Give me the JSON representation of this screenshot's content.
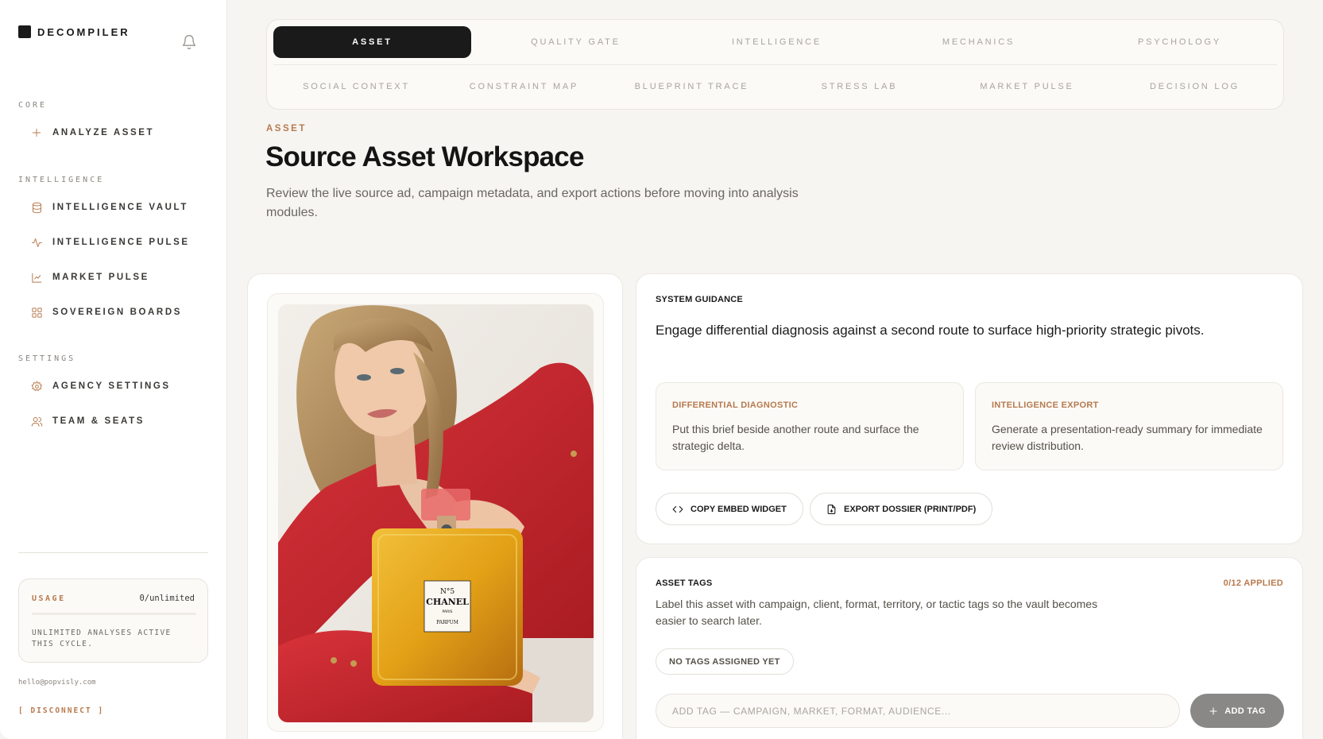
{
  "brand": {
    "name": "DECOMPILER"
  },
  "sidebar": {
    "sections": [
      {
        "title": "CORE"
      },
      {
        "title": "INTELLIGENCE"
      },
      {
        "title": "SETTINGS"
      }
    ],
    "items": [
      {
        "label": "ANALYZE ASSET",
        "icon": "plus-icon"
      },
      {
        "label": "INTELLIGENCE VAULT",
        "icon": "database-icon"
      },
      {
        "label": "INTELLIGENCE PULSE",
        "icon": "activity-icon"
      },
      {
        "label": "MARKET PULSE",
        "icon": "line-chart-icon"
      },
      {
        "label": "SOVEREIGN BOARDS",
        "icon": "grid-icon"
      },
      {
        "label": "AGENCY SETTINGS",
        "icon": "gear-icon"
      },
      {
        "label": "TEAM & SEATS",
        "icon": "users-icon"
      }
    ],
    "usage": {
      "title": "USAGE",
      "count": "0/unlimited",
      "fill_fraction": 0,
      "note": "UNLIMITED ANALYSES ACTIVE THIS CYCLE."
    },
    "email": "hello@popvisly.com",
    "disconnect": "[ DISCONNECT ]"
  },
  "tabs": {
    "row1": [
      "ASSET",
      "QUALITY GATE",
      "INTELLIGENCE",
      "MECHANICS",
      "PSYCHOLOGY"
    ],
    "row2": [
      "SOCIAL CONTEXT",
      "CONSTRAINT MAP",
      "BLUEPRINT TRACE",
      "STRESS LAB",
      "MARKET PULSE",
      "DECISION LOG"
    ],
    "active": "ASSET"
  },
  "header": {
    "crumb": "ASSET",
    "title": "Source Asset Workspace",
    "subtitle": "Review the live source ad, campaign metadata, and export actions before moving into analysis modules."
  },
  "asset": {
    "label_no": "N°5",
    "label_brand": "CHANEL",
    "label_city": "PARIS",
    "label_type": "PARFUM"
  },
  "guidance": {
    "label": "SYSTEM GUIDANCE",
    "text": "Engage differential diagnosis against a second route to surface high-priority strategic pivots.",
    "cards": [
      {
        "title": "DIFFERENTIAL DIAGNOSTIC",
        "body": "Put this brief beside another route and surface the strategic delta."
      },
      {
        "title": "INTELLIGENCE EXPORT",
        "body": "Generate a presentation-ready summary for immediate review distribution."
      }
    ],
    "copy_embed": "COPY EMBED WIDGET",
    "export_dossier": "EXPORT DOSSIER (PRINT/PDF)"
  },
  "tags": {
    "label": "ASSET TAGS",
    "count": "0/12 APPLIED",
    "description": "Label this asset with campaign, client, format, territory, or tactic tags so the vault becomes easier to search later.",
    "empty": "NO TAGS ASSIGNED YET",
    "input_placeholder": "ADD TAG — CAMPAIGN, MARKET, FORMAT, AUDIENCE...",
    "input_value": "",
    "add_button": "ADD TAG"
  },
  "colors": {
    "accent": "#b77a4e",
    "ink": "#1a1a1a",
    "background": "#f6f5f1",
    "dress_red": "#c8242b",
    "perfume_amber": "#e3a117"
  }
}
